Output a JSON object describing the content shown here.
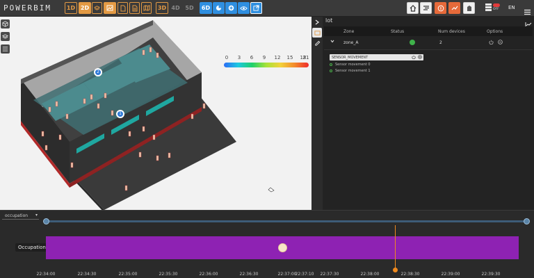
{
  "app": {
    "logo_text": "POWERBIM"
  },
  "toolbar": {
    "buttons_left": [
      {
        "name": "1d",
        "label": "1D"
      },
      {
        "name": "2d",
        "label": "2D"
      },
      {
        "name": "3d",
        "label": "3D"
      },
      {
        "name": "4d",
        "label": "4D"
      },
      {
        "name": "5d",
        "label": "5D"
      },
      {
        "name": "6d",
        "label": "6D"
      }
    ],
    "toggle_label": "OFF",
    "language": "EN"
  },
  "viewport": {
    "color_scale": {
      "ticks": [
        "0",
        "3",
        "6",
        "9",
        "12",
        "15",
        "18",
        "21"
      ],
      "colors": [
        "#2b6cf6",
        "#1ec8e0",
        "#1fd06a",
        "#a7e238",
        "#f2d23b",
        "#f38b2c",
        "#ef2b2b"
      ]
    },
    "markers": [
      "2",
      "1"
    ]
  },
  "panel": {
    "title": "lot",
    "columns": [
      "Zone",
      "Status",
      "Num devices",
      "Options"
    ],
    "rows": [
      {
        "zone": "zone_A",
        "status": "online",
        "num_devices": "2"
      }
    ],
    "sensor_group": "SENSOR_MOVEMENT",
    "sensors": [
      "Sensor movement 0",
      "Sensor movement 1"
    ]
  },
  "timeline": {
    "metric_select": "occupation",
    "range_left": "2",
    "range_right": "2",
    "track_label": "Occupation",
    "track_color": "#8e22b3",
    "cursor_color": "#f08a1e",
    "ticks": [
      "22:34:00",
      "22:34:30",
      "22:35:00",
      "22:35:30",
      "22:36:00",
      "22:36:30",
      "22:37:00",
      "22:37:10",
      "22:37:30",
      "22:38:00",
      "22:38:30",
      "22:39:00",
      "22:39:30"
    ]
  }
}
